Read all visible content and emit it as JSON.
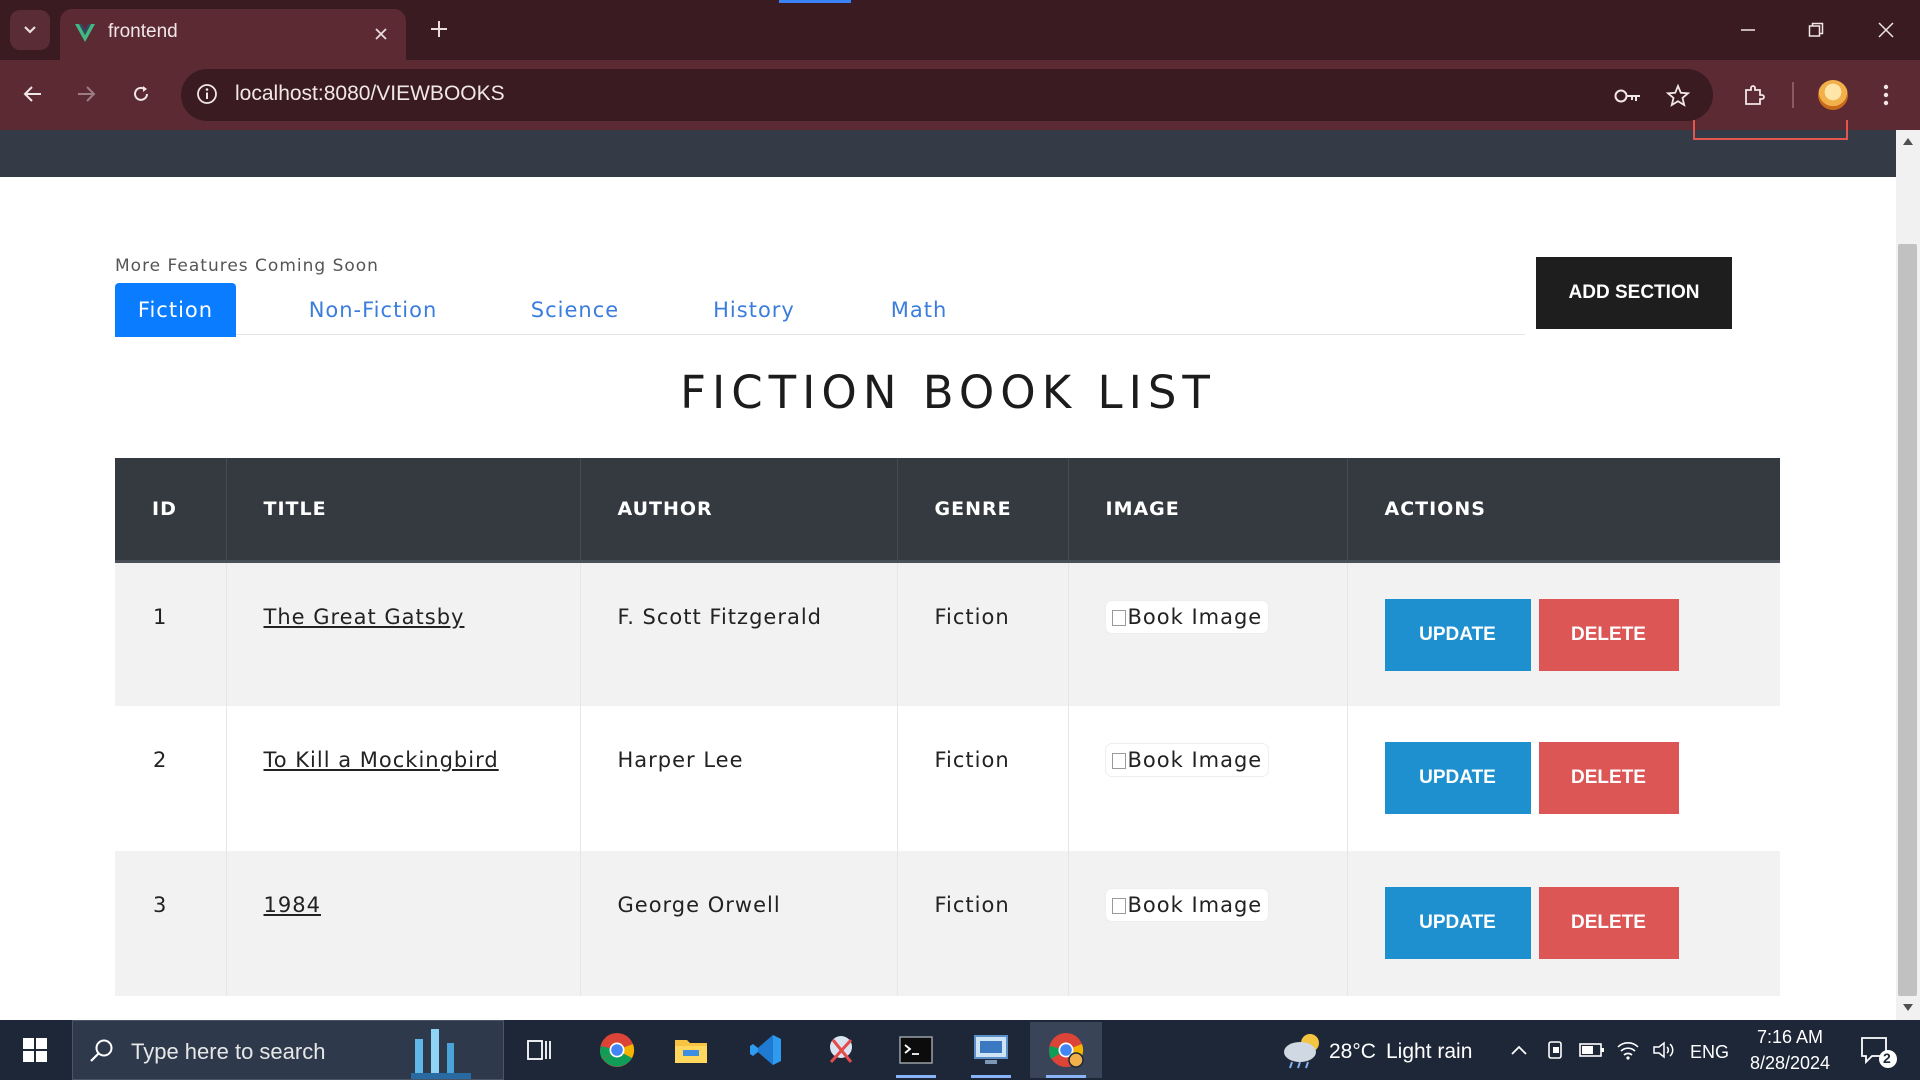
{
  "browser": {
    "tab_title": "frontend",
    "url": "localhost:8080/VIEWBOOKS"
  },
  "page": {
    "coming_soon": "More Features Coming Soon",
    "tabs": [
      {
        "label": "Fiction",
        "active": true
      },
      {
        "label": "Non-Fiction",
        "active": false
      },
      {
        "label": "Science",
        "active": false
      },
      {
        "label": "History",
        "active": false
      },
      {
        "label": "Math",
        "active": false
      }
    ],
    "add_section_label": "ADD SECTION",
    "list_title": "FICTION BOOK LIST",
    "table": {
      "headers": [
        "ID",
        "TITLE",
        "AUTHOR",
        "GENRE",
        "IMAGE",
        "ACTIONS"
      ],
      "rows": [
        {
          "id": "1",
          "title": "The Great Gatsby",
          "author": "F. Scott Fitzgerald",
          "genre": "Fiction",
          "image_alt": "Book Image"
        },
        {
          "id": "2",
          "title": "To Kill a Mockingbird",
          "author": "Harper Lee",
          "genre": "Fiction",
          "image_alt": "Book Image"
        },
        {
          "id": "3",
          "title": "1984",
          "author": "George Orwell",
          "genre": "Fiction",
          "image_alt": "Book Image"
        }
      ],
      "update_label": "UPDATE",
      "delete_label": "DELETE"
    }
  },
  "taskbar": {
    "search_placeholder": "Type here to search",
    "weather_temp": "28°C",
    "weather_desc": "Light rain",
    "language": "ENG",
    "time": "7:16 AM",
    "date": "8/28/2024",
    "notification_count": "2"
  },
  "colors": {
    "browser_frame": "#3a1b22",
    "browser_toolbar": "#5c2a33",
    "app_header": "#343a46",
    "active_tab": "#0a7cff",
    "update_button": "#1e90cf",
    "delete_button": "#dc5656",
    "table_header": "#343a40"
  }
}
